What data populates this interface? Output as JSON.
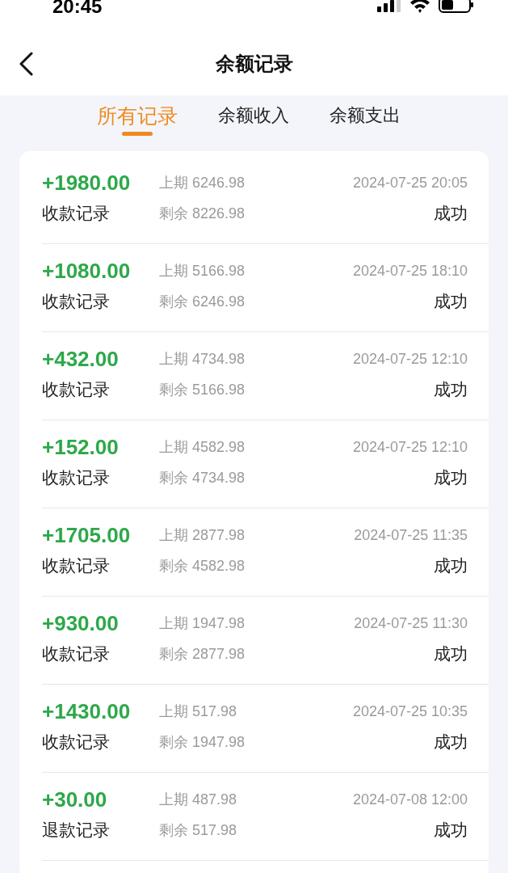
{
  "status_bar": {
    "time": "20:45"
  },
  "header": {
    "title": "余额记录"
  },
  "tabs": [
    {
      "label": "所有记录",
      "selected": true
    },
    {
      "label": "余额收入",
      "selected": false
    },
    {
      "label": "余额支出",
      "selected": false
    }
  ],
  "records": [
    {
      "amount": "+1980.00",
      "type": "收款记录",
      "previous": "上期 6246.98",
      "remaining": "剩余 8226.98",
      "time": "2024-07-25 20:05",
      "status": "成功"
    },
    {
      "amount": "+1080.00",
      "type": "收款记录",
      "previous": "上期 5166.98",
      "remaining": "剩余 6246.98",
      "time": "2024-07-25 18:10",
      "status": "成功"
    },
    {
      "amount": "+432.00",
      "type": "收款记录",
      "previous": "上期 4734.98",
      "remaining": "剩余 5166.98",
      "time": "2024-07-25 12:10",
      "status": "成功"
    },
    {
      "amount": "+152.00",
      "type": "收款记录",
      "previous": "上期 4582.98",
      "remaining": "剩余 4734.98",
      "time": "2024-07-25 12:10",
      "status": "成功"
    },
    {
      "amount": "+1705.00",
      "type": "收款记录",
      "previous": "上期 2877.98",
      "remaining": "剩余 4582.98",
      "time": "2024-07-25 11:35",
      "status": "成功"
    },
    {
      "amount": "+930.00",
      "type": "收款记录",
      "previous": "上期 1947.98",
      "remaining": "剩余 2877.98",
      "time": "2024-07-25 11:30",
      "status": "成功"
    },
    {
      "amount": "+1430.00",
      "type": "收款记录",
      "previous": "上期 517.98",
      "remaining": "剩余 1947.98",
      "time": "2024-07-25 10:35",
      "status": "成功"
    },
    {
      "amount": "+30.00",
      "type": "退款记录",
      "previous": "上期 487.98",
      "remaining": "剩余 517.98",
      "time": "2024-07-08 12:00",
      "status": "成功"
    }
  ]
}
